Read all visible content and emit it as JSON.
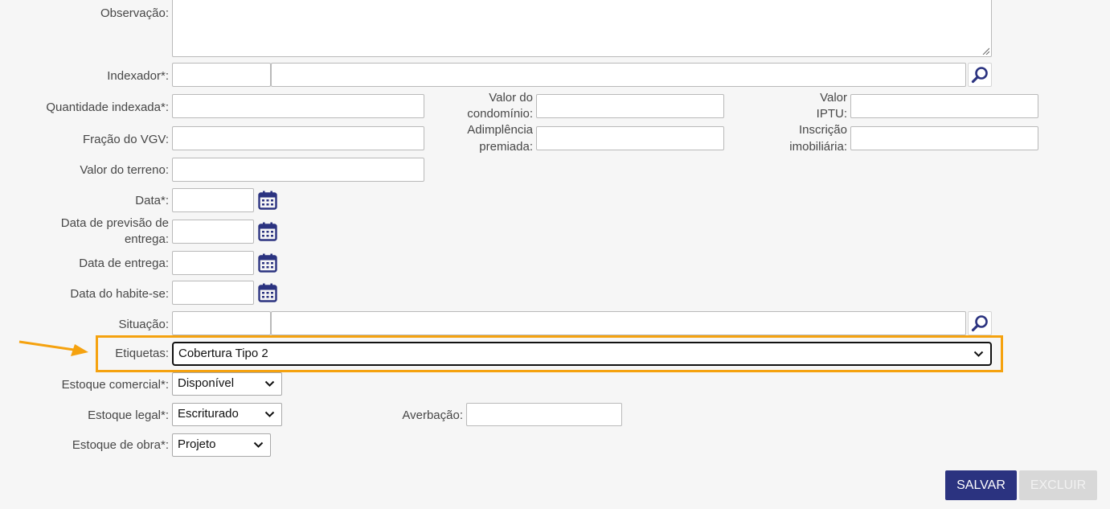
{
  "form": {
    "observacao_label": "Observação:",
    "indexador_label": "Indexador*:",
    "quantidade_indexada_label": "Quantidade indexada*:",
    "valor_condominio_label_1": "Valor do",
    "valor_condominio_label_2": "condomínio:",
    "valor_iptu_label_1": "Valor",
    "valor_iptu_label_2": "IPTU:",
    "fracao_vgv_label": "Fração do VGV:",
    "adimplencia_label_1": "Adimplência",
    "adimplencia_label_2": "premiada:",
    "inscricao_label_1": "Inscrição",
    "inscricao_label_2": "imobiliária:",
    "valor_terreno_label": "Valor do terreno:",
    "data_label": "Data*:",
    "data_previsao_label_1": "Data de previsão de",
    "data_previsao_label_2": "entrega:",
    "data_entrega_label": "Data de entrega:",
    "data_habite_label": "Data do habite-se:",
    "situacao_label": "Situação:",
    "etiquetas_label": "Etiquetas:",
    "etiquetas_value": "Cobertura Tipo 2",
    "estoque_comercial_label": "Estoque comercial*:",
    "estoque_comercial_value": "Disponível",
    "estoque_legal_label": "Estoque legal*:",
    "estoque_legal_value": "Escriturado",
    "averbacao_label": "Averbação:",
    "estoque_obra_label": "Estoque de obra*:",
    "estoque_obra_value": "Projeto"
  },
  "actions": {
    "salvar_label": "SALVAR",
    "excluir_label": "EXCLUIR"
  },
  "icons": {
    "search": "search-icon",
    "calendar": "calendar-icon",
    "chevron": "chevron-down-icon",
    "arrow": "arrow-right-icon"
  },
  "colors": {
    "highlight": "#f5a20f",
    "primary_button": "#2b3380",
    "disabled_button": "#d8d8d8",
    "icon": "#2b3380"
  }
}
